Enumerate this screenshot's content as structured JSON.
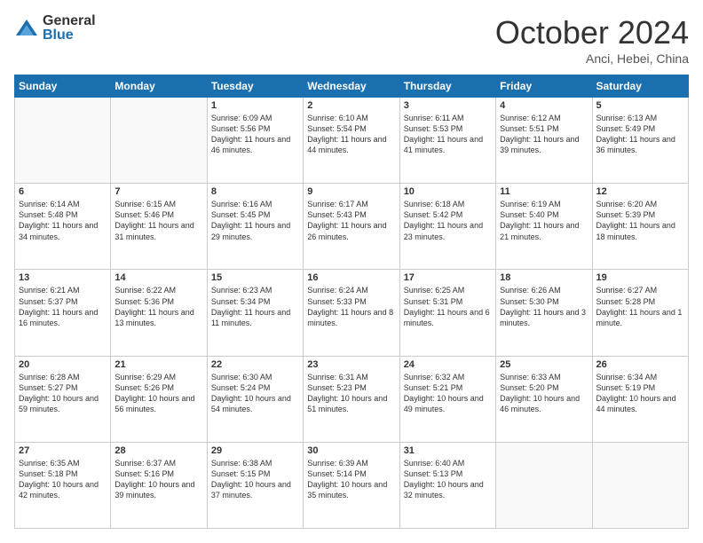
{
  "logo": {
    "general": "General",
    "blue": "Blue"
  },
  "header": {
    "month": "October 2024",
    "location": "Anci, Hebei, China"
  },
  "days_of_week": [
    "Sunday",
    "Monday",
    "Tuesday",
    "Wednesday",
    "Thursday",
    "Friday",
    "Saturday"
  ],
  "weeks": [
    [
      {
        "day": "",
        "info": ""
      },
      {
        "day": "",
        "info": ""
      },
      {
        "day": "1",
        "info": "Sunrise: 6:09 AM\nSunset: 5:56 PM\nDaylight: 11 hours and 46 minutes."
      },
      {
        "day": "2",
        "info": "Sunrise: 6:10 AM\nSunset: 5:54 PM\nDaylight: 11 hours and 44 minutes."
      },
      {
        "day": "3",
        "info": "Sunrise: 6:11 AM\nSunset: 5:53 PM\nDaylight: 11 hours and 41 minutes."
      },
      {
        "day": "4",
        "info": "Sunrise: 6:12 AM\nSunset: 5:51 PM\nDaylight: 11 hours and 39 minutes."
      },
      {
        "day": "5",
        "info": "Sunrise: 6:13 AM\nSunset: 5:49 PM\nDaylight: 11 hours and 36 minutes."
      }
    ],
    [
      {
        "day": "6",
        "info": "Sunrise: 6:14 AM\nSunset: 5:48 PM\nDaylight: 11 hours and 34 minutes."
      },
      {
        "day": "7",
        "info": "Sunrise: 6:15 AM\nSunset: 5:46 PM\nDaylight: 11 hours and 31 minutes."
      },
      {
        "day": "8",
        "info": "Sunrise: 6:16 AM\nSunset: 5:45 PM\nDaylight: 11 hours and 29 minutes."
      },
      {
        "day": "9",
        "info": "Sunrise: 6:17 AM\nSunset: 5:43 PM\nDaylight: 11 hours and 26 minutes."
      },
      {
        "day": "10",
        "info": "Sunrise: 6:18 AM\nSunset: 5:42 PM\nDaylight: 11 hours and 23 minutes."
      },
      {
        "day": "11",
        "info": "Sunrise: 6:19 AM\nSunset: 5:40 PM\nDaylight: 11 hours and 21 minutes."
      },
      {
        "day": "12",
        "info": "Sunrise: 6:20 AM\nSunset: 5:39 PM\nDaylight: 11 hours and 18 minutes."
      }
    ],
    [
      {
        "day": "13",
        "info": "Sunrise: 6:21 AM\nSunset: 5:37 PM\nDaylight: 11 hours and 16 minutes."
      },
      {
        "day": "14",
        "info": "Sunrise: 6:22 AM\nSunset: 5:36 PM\nDaylight: 11 hours and 13 minutes."
      },
      {
        "day": "15",
        "info": "Sunrise: 6:23 AM\nSunset: 5:34 PM\nDaylight: 11 hours and 11 minutes."
      },
      {
        "day": "16",
        "info": "Sunrise: 6:24 AM\nSunset: 5:33 PM\nDaylight: 11 hours and 8 minutes."
      },
      {
        "day": "17",
        "info": "Sunrise: 6:25 AM\nSunset: 5:31 PM\nDaylight: 11 hours and 6 minutes."
      },
      {
        "day": "18",
        "info": "Sunrise: 6:26 AM\nSunset: 5:30 PM\nDaylight: 11 hours and 3 minutes."
      },
      {
        "day": "19",
        "info": "Sunrise: 6:27 AM\nSunset: 5:28 PM\nDaylight: 11 hours and 1 minute."
      }
    ],
    [
      {
        "day": "20",
        "info": "Sunrise: 6:28 AM\nSunset: 5:27 PM\nDaylight: 10 hours and 59 minutes."
      },
      {
        "day": "21",
        "info": "Sunrise: 6:29 AM\nSunset: 5:26 PM\nDaylight: 10 hours and 56 minutes."
      },
      {
        "day": "22",
        "info": "Sunrise: 6:30 AM\nSunset: 5:24 PM\nDaylight: 10 hours and 54 minutes."
      },
      {
        "day": "23",
        "info": "Sunrise: 6:31 AM\nSunset: 5:23 PM\nDaylight: 10 hours and 51 minutes."
      },
      {
        "day": "24",
        "info": "Sunrise: 6:32 AM\nSunset: 5:21 PM\nDaylight: 10 hours and 49 minutes."
      },
      {
        "day": "25",
        "info": "Sunrise: 6:33 AM\nSunset: 5:20 PM\nDaylight: 10 hours and 46 minutes."
      },
      {
        "day": "26",
        "info": "Sunrise: 6:34 AM\nSunset: 5:19 PM\nDaylight: 10 hours and 44 minutes."
      }
    ],
    [
      {
        "day": "27",
        "info": "Sunrise: 6:35 AM\nSunset: 5:18 PM\nDaylight: 10 hours and 42 minutes."
      },
      {
        "day": "28",
        "info": "Sunrise: 6:37 AM\nSunset: 5:16 PM\nDaylight: 10 hours and 39 minutes."
      },
      {
        "day": "29",
        "info": "Sunrise: 6:38 AM\nSunset: 5:15 PM\nDaylight: 10 hours and 37 minutes."
      },
      {
        "day": "30",
        "info": "Sunrise: 6:39 AM\nSunset: 5:14 PM\nDaylight: 10 hours and 35 minutes."
      },
      {
        "day": "31",
        "info": "Sunrise: 6:40 AM\nSunset: 5:13 PM\nDaylight: 10 hours and 32 minutes."
      },
      {
        "day": "",
        "info": ""
      },
      {
        "day": "",
        "info": ""
      }
    ]
  ]
}
